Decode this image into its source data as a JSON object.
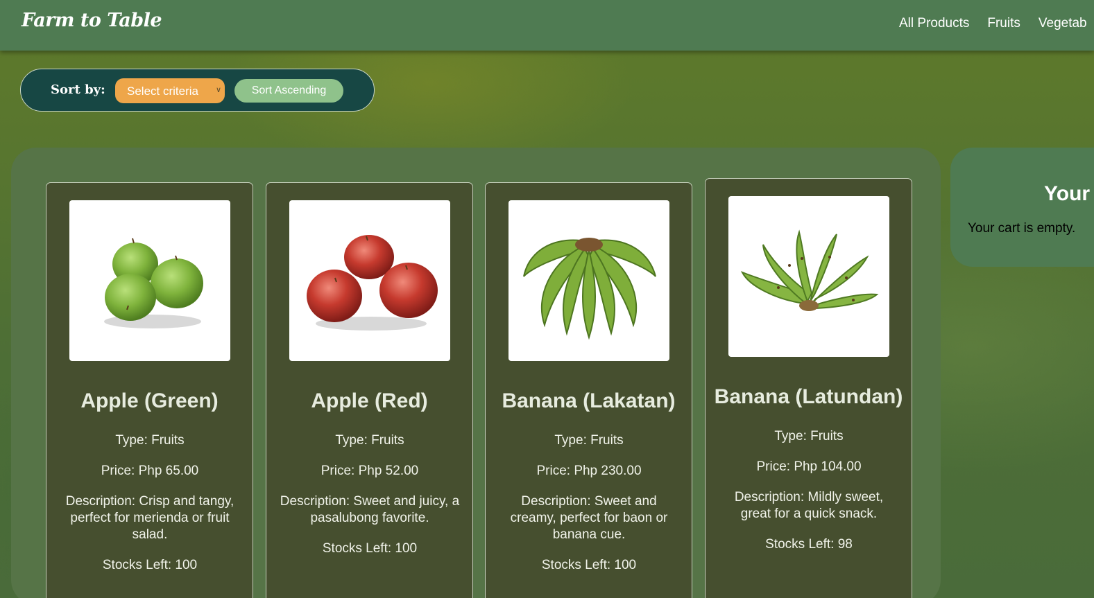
{
  "header": {
    "brand": "Farm to Table",
    "nav": [
      "All Products",
      "Fruits",
      "Vegetab"
    ]
  },
  "sort": {
    "label": "Sort by:",
    "select_value": "Select criteria",
    "button_label": "Sort Ascending"
  },
  "products": [
    {
      "name": "Apple (Green)",
      "image_icon": "green-apples-image",
      "type": "Type: Fruits",
      "price": "Price: Php 65.00",
      "description": "Description: Crisp and tangy, perfect for merienda or fruit salad.",
      "stocks": "Stocks Left: 100"
    },
    {
      "name": "Apple (Red)",
      "image_icon": "red-apples-image",
      "type": "Type: Fruits",
      "price": "Price: Php 52.00",
      "description": "Description: Sweet and juicy, a pasalubong favorite.",
      "stocks": "Stocks Left: 100"
    },
    {
      "name": "Banana (Lakatan)",
      "image_icon": "banana-bunch-image",
      "type": "Type: Fruits",
      "price": "Price: Php 230.00",
      "description": "Description: Sweet and creamy, perfect for baon or banana cue.",
      "stocks": "Stocks Left: 100"
    },
    {
      "name": "Banana (Latundan)",
      "image_icon": "banana-bunch-image",
      "type": "Type: Fruits",
      "price": "Price: Php 104.00",
      "description": "Description: Mildly sweet, great for a quick snack.",
      "stocks": "Stocks Left: 98"
    }
  ],
  "cart": {
    "title": "Your",
    "empty_message": "Your cart is empty."
  },
  "colors": {
    "navbar": "#4f7b52",
    "sortbar": "#174744",
    "select": "#eea64a",
    "sort_button": "#8fc28b",
    "card": "#464f2f",
    "panel": "#567447"
  }
}
